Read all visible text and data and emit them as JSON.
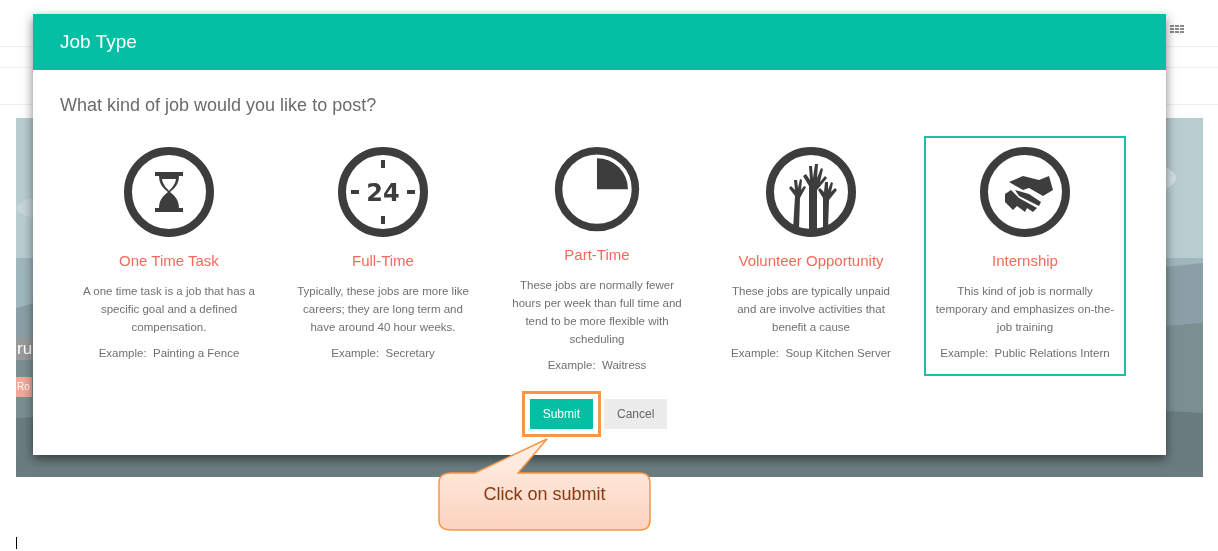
{
  "background": {
    "fragments": [
      {
        "kind": "label",
        "text": "ru"
      },
      {
        "kind": "tag",
        "text": "Ro"
      }
    ]
  },
  "dialog": {
    "title": "Job Type",
    "question": "What kind of job would you like to post?",
    "options": [
      {
        "kind": "hourglass",
        "title": "One Time Task",
        "description": "A one time task is a job that has a specific goal and a defined compensation.",
        "example": "Example:  Painting a Fence",
        "selected": false
      },
      {
        "kind": "clock",
        "icon_label": "24",
        "title": "Full-Time",
        "description": "Typically, these jobs are more like careers; they are long term and have around 40 hour weeks.",
        "example": "Example:  Secretary",
        "selected": false
      },
      {
        "kind": "pie",
        "title": "Part-Time",
        "description": "These jobs are normally fewer hours per week than full time and tend to be more flexible with scheduling",
        "example": "Example:  Waitress",
        "selected": false
      },
      {
        "kind": "hands",
        "title": "Volunteer Opportunity",
        "description": "These jobs are typically unpaid and are involve activities that benefit a cause",
        "example": "Example:  Soup Kitchen Server",
        "selected": false
      },
      {
        "kind": "handshake",
        "title": "Internship",
        "description": "This kind of job is normally temporary and emphasizes on-the-job training",
        "example": "Example:  Public Relations Intern",
        "selected": true
      }
    ],
    "buttons": [
      {
        "kind": "primary",
        "label": "Submit",
        "highlighted": true
      },
      {
        "kind": "secondary",
        "label": "Cancel",
        "highlighted": false
      }
    ]
  },
  "callout": {
    "text": "Click on submit"
  }
}
